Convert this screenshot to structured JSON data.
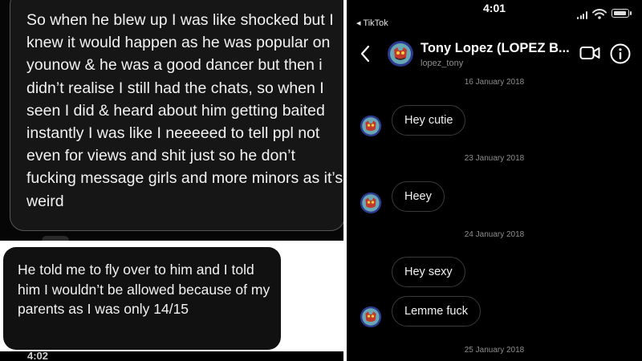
{
  "left_top": {
    "message_text": "So when he blew up I was like shocked but I knew it would happen as he was popular on younow & he was a good dancer but then i didn’t realise I still had the chats, so when I seen I did & heard about him getting baited instantly I was like I neeeeed to tell ppl not even for views and shit just so he don’t fucking message girls and more minors as it’s weird"
  },
  "left_bottom": {
    "message_text": "He told me to fly over to him and I told him I wouldn’t be allowed because of my parents as I was only 14/15",
    "partial_time": "4:02"
  },
  "status_bar": {
    "time": "4:01",
    "back_app": "◂ TikTok"
  },
  "chat_header": {
    "name": "Tony Lopez (LOPEZ B...",
    "username": "lopez_tony"
  },
  "chat": {
    "dates": [
      "16 January 2018",
      "23 January 2018",
      "24 January 2018",
      "25 January 2018"
    ],
    "messages": [
      "Hey cutie",
      "Heey",
      "Hey sexy",
      "Lemme fuck"
    ]
  },
  "colors": {
    "background": "#000000",
    "bubble_border": "#3a3a3a",
    "muted_text": "#8e8e8e",
    "avatar_ring": "#2b3a8f"
  },
  "icons": {
    "back": "chevron-left-icon",
    "video": "video-camera-icon",
    "info": "info-icon",
    "signal": "signal-icon",
    "wifi": "wifi-icon",
    "battery": "battery-icon",
    "avatar": "profile-avatar"
  }
}
